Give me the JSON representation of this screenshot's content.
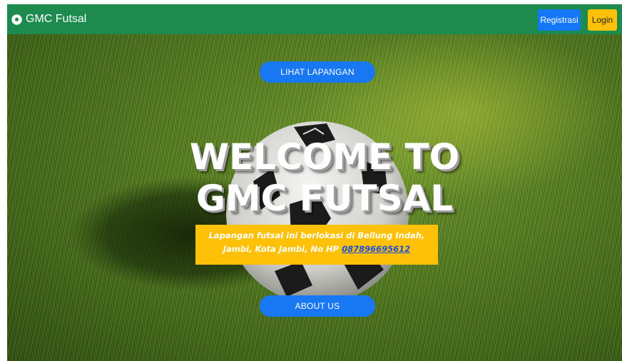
{
  "navbar": {
    "brand": "GMC Futsal",
    "brand_icon": "soccer-ball-icon",
    "registrasi_label": "Registrasi",
    "login_label": "Login",
    "colors": {
      "bar": "#1d8a4e",
      "registrasi": "#1477f8",
      "login": "#ffc107"
    }
  },
  "hero": {
    "top_button": "LIHAT LAPANGAN",
    "title_line1": "WELCOME TO",
    "title_line2": "GMC FUTSAL",
    "info_text": "Lapangan futsal ini berlokasi di Bellung Indah, Jambi, Kota Jambi, No HP",
    "phone": "087896695612",
    "bottom_button": "ABOUT US",
    "colors": {
      "button": "#1877f2",
      "info_box": "#ffc107"
    }
  }
}
